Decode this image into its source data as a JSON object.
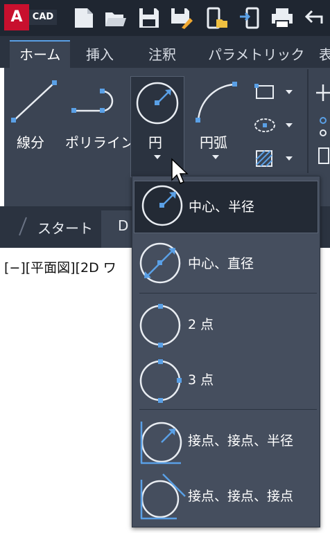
{
  "app": {
    "logo_letter": "A",
    "logo_text": "CAD"
  },
  "quick_access": [
    "new-icon",
    "open-icon",
    "save-icon",
    "save-as-icon",
    "open-from-mobile-icon",
    "save-to-mobile-icon",
    "print-icon",
    "undo-icon"
  ],
  "tabs": [
    {
      "label": "ホーム",
      "active": true
    },
    {
      "label": "挿入"
    },
    {
      "label": "注釈"
    },
    {
      "label": "パラメトリック"
    },
    {
      "label": "表"
    }
  ],
  "ribbon": {
    "line_label": "線分",
    "polyline_label": "ポリライン",
    "circle_label": "円",
    "arc_label": "円弧"
  },
  "file_tabs": {
    "start_label": "スタート",
    "drawing_label": "D"
  },
  "viewport_label": "[−][平面図][2D ワ",
  "circle_menu": [
    {
      "label": "中心、半径",
      "icon": "circle-center-radius-icon",
      "selected": true
    },
    {
      "label": "中心、直径",
      "icon": "circle-center-diameter-icon"
    },
    {
      "label": "2 点",
      "icon": "circle-2-point-icon"
    },
    {
      "label": "3 点",
      "icon": "circle-3-point-icon"
    },
    {
      "label": "接点、接点、半径",
      "icon": "circle-tan-tan-radius-icon"
    },
    {
      "label": "接点、接点、接点",
      "icon": "circle-tan-tan-tan-icon"
    }
  ],
  "colors": {
    "accent": "#5aa0e6",
    "panel": "#3b4453",
    "dark": "#1f2631",
    "menu": "#454e5e"
  }
}
